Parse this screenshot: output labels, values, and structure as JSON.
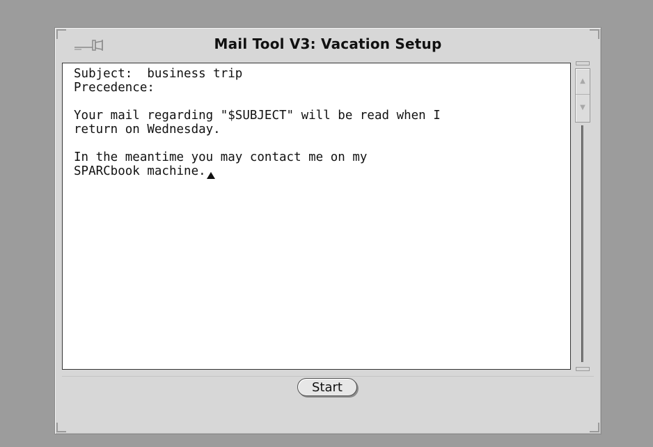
{
  "window": {
    "title": "Mail Tool V3: Vacation Setup"
  },
  "icons": {
    "pushpin": "pushpin-icon",
    "scroll_up": "scroll-up-arrow-icon",
    "scroll_down": "scroll-down-arrow-icon"
  },
  "message": {
    "lines": [
      "Subject:  business trip",
      "Precedence:",
      "",
      "Your mail regarding \"$SUBJECT\" will be read when I",
      "return on Wednesday.",
      "",
      "In the meantime you may contact me on my",
      "SPARCbook machine."
    ]
  },
  "buttons": {
    "start_label": "Start"
  }
}
